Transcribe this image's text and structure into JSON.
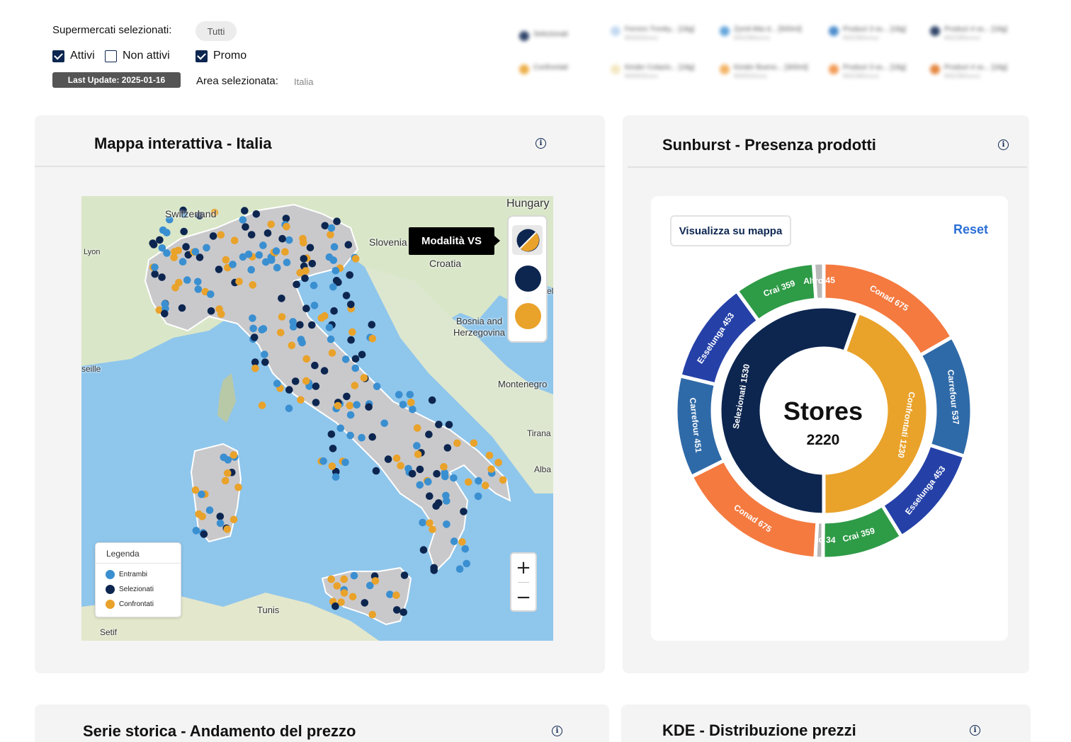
{
  "filters": {
    "supermarkets_label": "Supermercati selezionati:",
    "supermarkets_value": "Tutti",
    "checkboxes": [
      {
        "label": "Attivi",
        "checked": true
      },
      {
        "label": "Non attivi",
        "checked": false
      },
      {
        "label": "Promo",
        "checked": true
      }
    ],
    "last_update": "Last Update: 2025-01-16",
    "area_label": "Area selezionata:",
    "area_value": "Italia"
  },
  "product_legend": {
    "groups": [
      {
        "name": "Selezionati",
        "color": "#0d2650"
      },
      {
        "name": "Confrontati",
        "color": "#e9a22a"
      }
    ],
    "selected_products": [
      {
        "name": "Ferrero Tronky... [18g]",
        "code": "8000500xxxx",
        "color": "#b9d3ef"
      },
      {
        "name": "Zymil Alta d... [500ml]",
        "code": "8002380xxxxx",
        "color": "#4a97d6"
      },
      {
        "name": "Product 3 ss... [18g]",
        "code": "8002380xxxxx",
        "color": "#2e79c4"
      },
      {
        "name": "Product 4 ss... [18g]",
        "code": "8002380xxxxx",
        "color": "#0d2650"
      }
    ],
    "compared_products": [
      {
        "name": "Kinder Colazio... [18g]",
        "code": "8000500xxxx",
        "color": "#f2e3b7"
      },
      {
        "name": "Kinder Bueno... [300ml]",
        "code": "8000500xxxx",
        "color": "#f1a64a"
      },
      {
        "name": "Product 3 ss... [18g]",
        "code": "8002380xxxxx",
        "color": "#f08a3a"
      },
      {
        "name": "Product 4 ss... [18g]",
        "code": "8002380xxxxx",
        "color": "#e0721e"
      }
    ]
  },
  "map_card": {
    "title": "Mappa interattiva - Italia",
    "info": "i",
    "labels": [
      "Switzerland",
      "Hungary",
      "Lyon",
      "Slovenia",
      "Croatia",
      "Bosnia and",
      "Herzegovina",
      "seille",
      "Montenegro",
      "Tirana",
      "Alba",
      "Tunis",
      "Setif",
      "el"
    ],
    "tooltip": "Modalità VS",
    "modes": [
      {
        "name": "vs",
        "active": true
      },
      {
        "name": "selezionati",
        "active": false
      },
      {
        "name": "confrontati",
        "active": false
      }
    ],
    "legend": {
      "title": "Legenda",
      "items": [
        {
          "label": "Entrambi",
          "color": "#3a8fd0"
        },
        {
          "label": "Selezionati",
          "color": "#0d2650"
        },
        {
          "label": "Confrontati",
          "color": "#e9a22a"
        }
      ]
    },
    "zoom_in": "+",
    "zoom_out": "−"
  },
  "sunburst_card": {
    "title": "Sunburst - Presenza prodotti",
    "info": "i",
    "button_map": "Visualizza su mappa",
    "button_reset": "Reset",
    "center_title": "Stores",
    "center_value": "2220"
  },
  "chart_data": {
    "type": "sunburst",
    "total": 2220,
    "inner": [
      {
        "name": "Selezionati",
        "value": 1530,
        "color": "#0d2650"
      },
      {
        "name": "Confrontati",
        "value": 1230,
        "color": "#e9a22a"
      }
    ],
    "outer": [
      {
        "name": "Conad",
        "value": 675,
        "color": "#f47a40"
      },
      {
        "name": "Carrefour",
        "value": 537,
        "color": "#2f6aa8"
      },
      {
        "name": "Esselunga",
        "value": 453,
        "color": "#2541a8"
      },
      {
        "name": "Crai",
        "value": 359,
        "color": "#2e9b47"
      },
      {
        "name": "Altro",
        "value": 34,
        "color": "#b9b9b9"
      },
      {
        "name": "Conad",
        "value": 675,
        "color": "#f47a40"
      },
      {
        "name": "Carrefour",
        "value": 451,
        "color": "#2f6aa8"
      },
      {
        "name": "Esselunga",
        "value": 453,
        "color": "#2541a8"
      },
      {
        "name": "Crai",
        "value": 359,
        "color": "#2e9b47"
      },
      {
        "name": "Altro",
        "value": 45,
        "color": "#b9b9b9"
      }
    ]
  },
  "bottom_cards": [
    {
      "title": "Serie storica - Andamento del prezzo",
      "info": "i"
    },
    {
      "title": "KDE - Distribuzione prezzi",
      "info": "i"
    }
  ]
}
